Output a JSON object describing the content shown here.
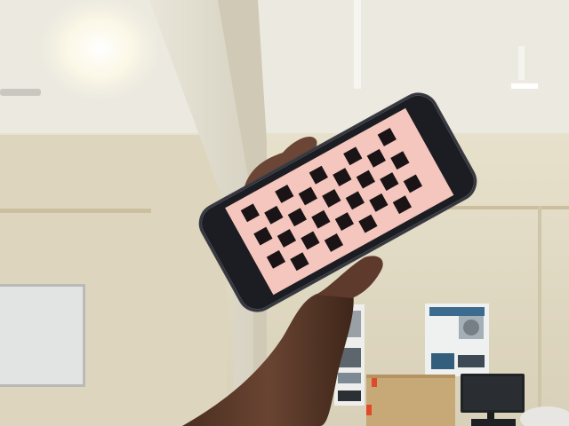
{
  "scene": {
    "subjects": [
      "ceiling-light",
      "ceiling-fan",
      "support-pillar",
      "whiteboard",
      "hand-holding-phone",
      "smartphone",
      "checkerboard-pattern",
      "wall-poster",
      "cardboard-box",
      "monitor"
    ],
    "checkerboard": {
      "rows": 6,
      "cols": 9,
      "light_color": "#f4c6be",
      "dark_color": "#1a1416"
    },
    "colors": {
      "wall": "#ddd6c0",
      "ceiling": "#e8e6dc",
      "phone_body": "#1c1d22",
      "skin": "#5a3a2a"
    }
  }
}
